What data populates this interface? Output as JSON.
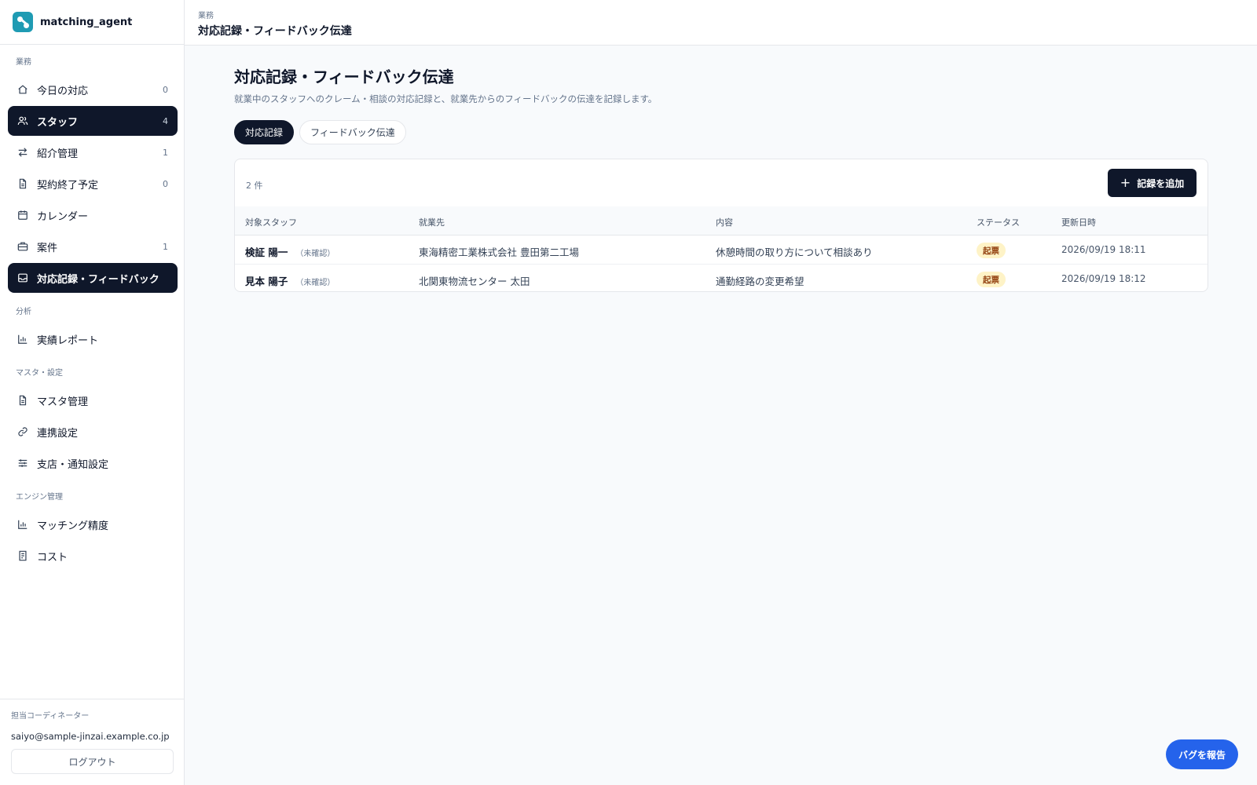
{
  "brand": {
    "name": "matching_agent"
  },
  "sidebar": {
    "sections": [
      {
        "label": "業務"
      },
      {
        "label": "分析"
      },
      {
        "label": "マスタ・設定"
      },
      {
        "label": "エンジン管理"
      }
    ],
    "items": [
      {
        "label": "今日の対応",
        "count": "0",
        "icon": "home-icon"
      },
      {
        "label": "スタッフ",
        "count": "4",
        "icon": "users-icon"
      },
      {
        "label": "紹介管理",
        "count": "1",
        "icon": "arrows-exchange-icon"
      },
      {
        "label": "契約終了予定",
        "count": "0",
        "icon": "document-icon"
      },
      {
        "label": "カレンダー",
        "count": "",
        "icon": "calendar-icon"
      },
      {
        "label": "案件",
        "count": "1",
        "icon": "briefcase-icon"
      },
      {
        "label": "対応記録・フィードバック",
        "count": "",
        "icon": "inbox-icon"
      },
      {
        "label": "実績レポート",
        "count": "",
        "icon": "bar-chart-icon"
      },
      {
        "label": "マスタ管理",
        "count": "",
        "icon": "document-icon"
      },
      {
        "label": "連携設定",
        "count": "",
        "icon": "link-icon"
      },
      {
        "label": "支店・通知設定",
        "count": "",
        "icon": "sliders-icon"
      },
      {
        "label": "マッチング精度",
        "count": "",
        "icon": "bar-chart-icon"
      },
      {
        "label": "コスト",
        "count": "",
        "icon": "receipt-icon"
      }
    ],
    "footer": {
      "label": "担当コーディネーター",
      "email": "saiyo@sample-jinzai.example.co.jp",
      "logout": "ログアウト"
    }
  },
  "header": {
    "crumb": "業務",
    "title": "対応記録・フィードバック伝達"
  },
  "main": {
    "title": "対応記録・フィードバック伝達",
    "description": "就業中のスタッフへのクレーム・相談の対応記録と、就業先からのフィードバックの伝達を記録します。",
    "tabs": [
      {
        "label": "対応記録"
      },
      {
        "label": "フィードバック伝達"
      }
    ],
    "count": "2 件",
    "add_button": "記録を追加",
    "table": {
      "headers": [
        "対象スタッフ",
        "就業先",
        "内容",
        "ステータス",
        "更新日時"
      ],
      "rows": [
        {
          "staff": "検証 陽一",
          "tag": "（未確認）",
          "workplace": "東海精密工業株式会社 豊田第二工場",
          "content": "休憩時間の取り方について相談あり",
          "status": "起票",
          "updated": "2026/09/19 18:11"
        },
        {
          "staff": "見本 陽子",
          "tag": "（未確認）",
          "workplace": "北関東物流センター 太田",
          "content": "通勤経路の変更希望",
          "status": "起票",
          "updated": "2026/09/19 18:12"
        }
      ]
    }
  },
  "bug_button": "バグを報告",
  "colors": {
    "primary": "#0f172a",
    "accent": "#2563eb",
    "brand": "#1f9bb3",
    "badge_bg": "#fef3c7",
    "badge_text": "#92400e"
  }
}
